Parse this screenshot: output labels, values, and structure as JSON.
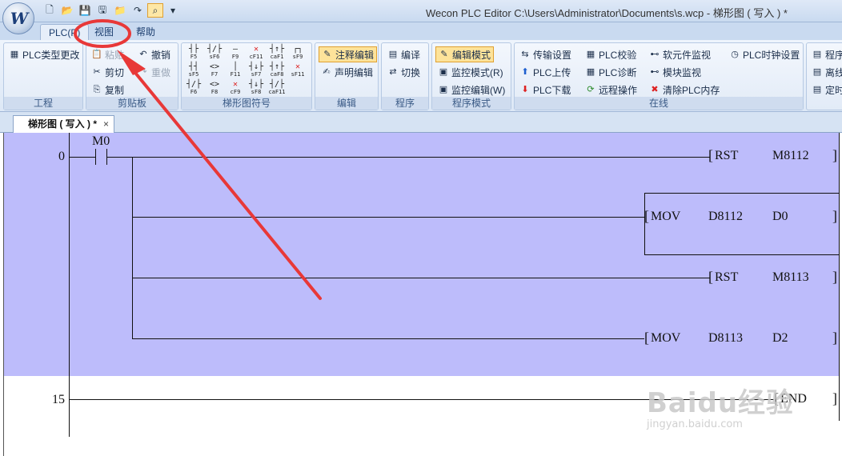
{
  "window": {
    "title": "Wecon PLC Editor  C:\\Users\\Administrator\\Documents\\s.wcp  - 梯形图 ( 写入 ) *",
    "logo": "W"
  },
  "quick_access": [
    {
      "icon": "new-file-icon",
      "glyph": "🗋"
    },
    {
      "icon": "open-folder-icon",
      "glyph": "📂"
    },
    {
      "icon": "save-icon",
      "glyph": "💾"
    },
    {
      "icon": "save-as-icon",
      "glyph": "🖫"
    },
    {
      "icon": "folder-icon",
      "glyph": "📁"
    },
    {
      "icon": "redo-icon",
      "glyph": "↷"
    },
    {
      "icon": "find-icon",
      "glyph": "⌕"
    },
    {
      "icon": "dropdown-icon",
      "glyph": "▾"
    }
  ],
  "ribbon_tabs": [
    "PLC(P)",
    "视图",
    "帮助"
  ],
  "groups": {
    "project": {
      "label": "工程",
      "plc_type": "PLC类型更改"
    },
    "clipboard": {
      "label": "剪贴板",
      "paste": "粘贴",
      "cut": "剪切",
      "copy": "复制",
      "undo": "撤销",
      "redo": "重做"
    },
    "ladder_symbols": {
      "label": "梯形图符号",
      "row1": [
        "F5",
        "sF6",
        "F9",
        "cF11",
        "caF1",
        "sF9"
      ],
      "row2": [
        "sF5",
        "F7",
        "F11",
        "sF7",
        "caF8",
        "sF11"
      ],
      "row3": [
        "F6",
        "F8",
        "cF9",
        "sF8",
        "caF11",
        ""
      ]
    },
    "edit": {
      "label": "编辑",
      "comment_edit": "注释编辑",
      "statement_edit": "声明编辑"
    },
    "program": {
      "label": "程序",
      "compile": "编译",
      "switch": "切换"
    },
    "program_mode": {
      "label": "程序模式",
      "edit_mode": "编辑模式",
      "monitor_mode": "监控模式(R)",
      "monitor_edit": "监控编辑(W)"
    },
    "online": {
      "label": "在线",
      "transfer_settings": "传输设置",
      "plc_upload": "PLC上传",
      "plc_download": "PLC下载",
      "plc_verify": "PLC校验",
      "plc_diagnose": "PLC诊断",
      "remote_op": "远程操作",
      "soft_monitor": "软元件监视",
      "module_monitor": "模块监视",
      "clear_memory": "清除PLC内存",
      "clock_setting": "PLC时钟设置"
    },
    "extra": {
      "item1": "程序",
      "item2": "离线",
      "item3": "定时"
    }
  },
  "doc_tab": {
    "label": "梯形图 ( 写入 ) *",
    "close": "×"
  },
  "ladder": {
    "step_numbers": [
      "0",
      "15"
    ],
    "contact": "M0",
    "rungs": [
      {
        "instr": "RST",
        "op1": "M8112",
        "op2": ""
      },
      {
        "instr": "MOV",
        "op1": "D8112",
        "op2": "D0"
      },
      {
        "instr": "RST",
        "op1": "M8113",
        "op2": ""
      },
      {
        "instr": "MOV",
        "op1": "D8113",
        "op2": "D2"
      }
    ],
    "end": "END"
  },
  "watermark": {
    "brand": "Baidu经验",
    "url": "jingyan.baidu.com"
  },
  "colors": {
    "selection": "#bdbcfb",
    "annotation": "#e83838"
  }
}
